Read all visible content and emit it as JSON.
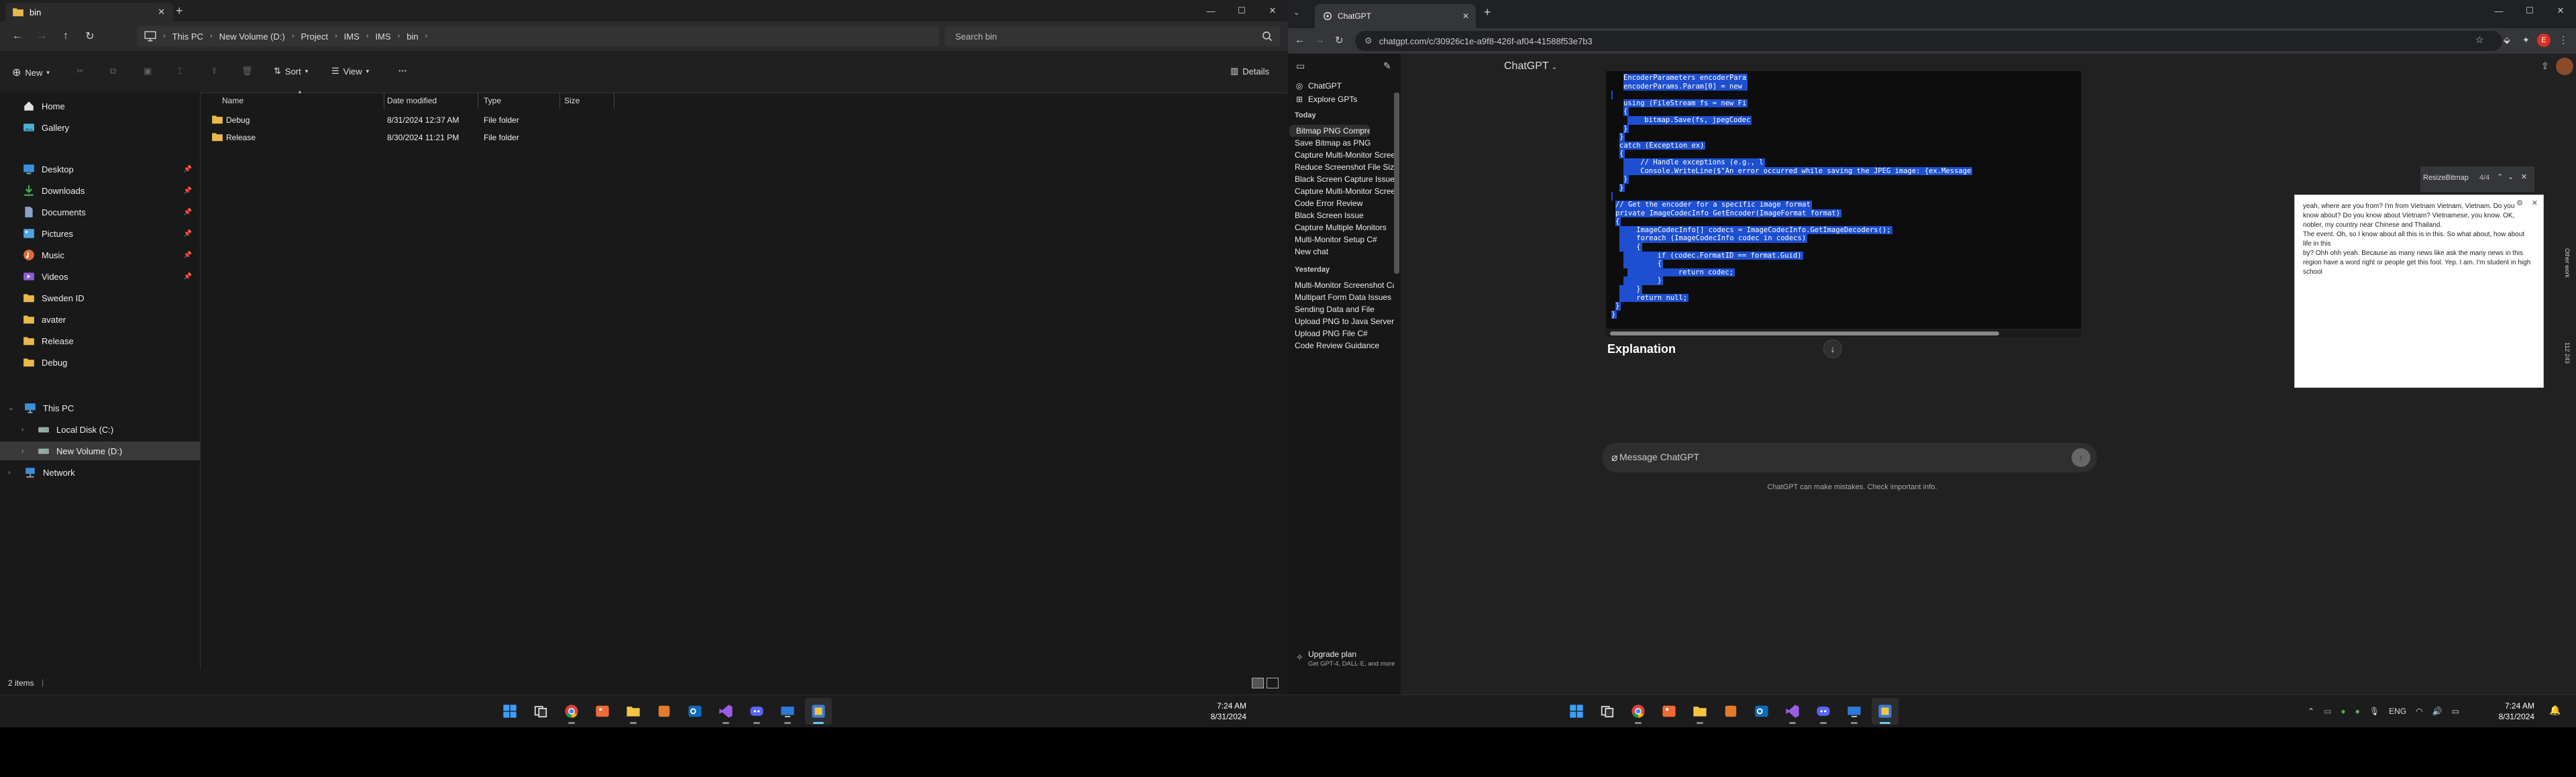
{
  "explorer": {
    "tab_title": "bin",
    "breadcrumbs": [
      "This PC",
      "New Volume (D:)",
      "Project",
      "IMS",
      "IMS",
      "bin"
    ],
    "search_placeholder": "Search bin",
    "toolbar": {
      "new": "New",
      "sort": "Sort",
      "view": "View",
      "more": "···",
      "details": "Details"
    },
    "nav": {
      "quick": [
        {
          "label": "Home",
          "icon": "home-icon"
        },
        {
          "label": "Gallery",
          "icon": "gallery-icon"
        }
      ],
      "pinned": [
        {
          "label": "Desktop",
          "icon": "desktop-icon"
        },
        {
          "label": "Downloads",
          "icon": "downloads-icon"
        },
        {
          "label": "Documents",
          "icon": "documents-icon"
        },
        {
          "label": "Pictures",
          "icon": "pictures-icon"
        },
        {
          "label": "Music",
          "icon": "music-icon"
        },
        {
          "label": "Videos",
          "icon": "videos-icon"
        },
        {
          "label": "Sweden ID",
          "icon": "folder-icon"
        },
        {
          "label": "avater",
          "icon": "folder-icon"
        },
        {
          "label": "Release",
          "icon": "folder-icon"
        },
        {
          "label": "Debug",
          "icon": "folder-icon"
        }
      ],
      "tree": [
        {
          "label": "This PC",
          "icon": "pc-icon"
        },
        {
          "label": "Local Disk (C:)",
          "icon": "drive-icon"
        },
        {
          "label": "New Volume (D:)",
          "icon": "drive-icon"
        },
        {
          "label": "Network",
          "icon": "network-icon"
        }
      ]
    },
    "columns": [
      "Name",
      "Date modified",
      "Type",
      "Size"
    ],
    "files": [
      {
        "name": "Debug",
        "date": "8/31/2024 12:37 AM",
        "type": "File folder",
        "size": ""
      },
      {
        "name": "Release",
        "date": "8/30/2024 11:21 PM",
        "type": "File folder",
        "size": ""
      }
    ],
    "status": "2 items"
  },
  "chrome": {
    "tab_title": "ChatGPT",
    "url": "chatgpt.com/c/30926c1e-a9f8-426f-af04-41588f53e7b3",
    "profile_initial": "E"
  },
  "chatgpt": {
    "sidebar_top": [
      {
        "label": "ChatGPT",
        "icon": "chatgpt-logo-icon"
      },
      {
        "label": "Explore GPTs",
        "icon": "grid-icon"
      }
    ],
    "groups": [
      {
        "title": "Today",
        "items": [
          "Bitmap PNG Compression C#",
          "Save Bitmap as PNG",
          "Capture Multi-Monitor Screens",
          "Reduce Screenshot File Size",
          "Black Screen Capture Issue",
          "Capture Multi-Monitor Screens",
          "Code Error Review",
          "Black Screen Issue",
          "Capture Multiple Monitors",
          "Multi-Monitor Setup C#",
          "New chat"
        ]
      },
      {
        "title": "Yesterday",
        "items": [
          "Multi-Monitor Screenshot Capture",
          "Multipart Form Data Issues",
          "Sending Data and File",
          "Upload PNG to Java Server",
          "Upload PNG File C#",
          "Code Review Guidance"
        ]
      }
    ],
    "upgrade": {
      "title": "Upgrade plan",
      "subtitle": "Get GPT-4, DALL·E, and more"
    },
    "model_label": "ChatGPT",
    "code_lines": [
      "EncoderParameters encoderPara",
      "encoderParams.Param[0] = new ",
      "",
      "using (FileStream fs = new Fi",
      "{",
      "    bitmap.Save(fs, jpegCodec",
      "}",
      "}",
      "catch (Exception ex)",
      "{",
      "    // Handle exceptions (e.g., l",
      "    Console.WriteLine($\"An error occurred while saving the JPEG image: {ex.Message",
      "}",
      "}",
      "",
      "// Get the encoder for a specific image format",
      "private ImageCodecInfo GetEncoder(ImageFormat format)",
      "{",
      "    ImageCodecInfo[] codecs = ImageCodecInfo.GetImageDecoders();",
      "    foreach (ImageCodecInfo codec in codecs)",
      "    {",
      "        if (codec.FormatID == format.Guid)",
      "        {",
      "            return codec;",
      "        }",
      "    }",
      "    return null;",
      "}",
      "}"
    ],
    "explanation_heading": "Explanation",
    "message_placeholder": "Message ChatGPT",
    "disclaimer": "ChatGPT can make mistakes. Check important info."
  },
  "find_bar": {
    "query": "ResizeBitmap",
    "count": "4/4"
  },
  "popup_text": "yeah, where are you from? I'm from Vietnam Vietnam, Vietnam. Do you know about? Do you know about Vietnam? Vietnamese, you know. OK, nobler, my country near Chinese and Thailand.\nThe event. Oh, so I know about all this is in this. So what about, how about life in this\nby? Ohh ohh yeah. Because as many news like ask the many news in this region have a word right or people get this fool. Yep. I am. I'm student in high school",
  "taskbar_left": {
    "time": "7:24 AM",
    "date": "8/31/2024"
  },
  "taskbar_right": {
    "time": "7:24 AM",
    "date": "8/31/2024",
    "lang": "ENG"
  },
  "edge_label": "Other work",
  "edge_number": "112 243"
}
